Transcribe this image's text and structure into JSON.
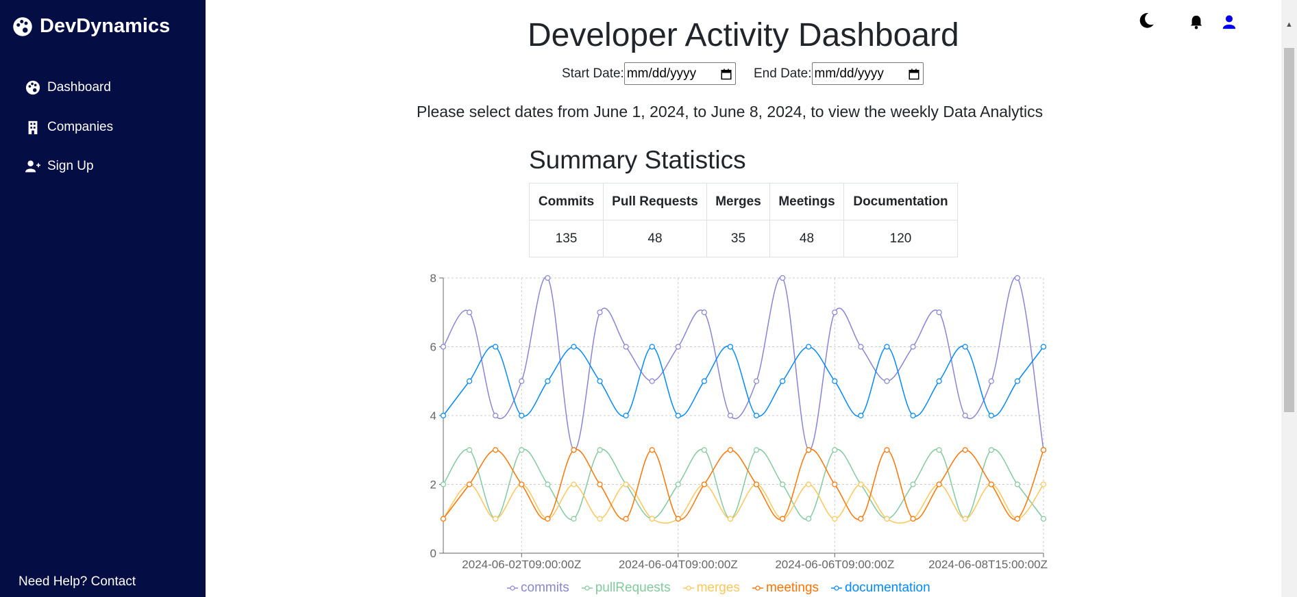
{
  "sidebar": {
    "brand": "DevDynamics",
    "items": [
      {
        "label": "Dashboard",
        "icon": "palette-icon"
      },
      {
        "label": "Companies",
        "icon": "building-icon"
      },
      {
        "label": "Sign Up",
        "icon": "user-plus-icon"
      }
    ],
    "help": "Need Help? Contact"
  },
  "header": {
    "icons": [
      "moon-icon",
      "bell-icon",
      "user-icon"
    ]
  },
  "main": {
    "title": "Developer Activity Dashboard",
    "start_label": "Start Date:",
    "end_label": "End Date:",
    "start_placeholder": "mm/dd/yyyy",
    "end_placeholder": "mm/dd/yyyy",
    "hint": "Please select dates from June 1, 2024, to June 8, 2024, to view the weekly Data Analytics",
    "summary_title": "Summary Statistics",
    "table": {
      "headers": [
        "Commits",
        "Pull Requests",
        "Merges",
        "Meetings",
        "Documentation"
      ],
      "values": [
        "135",
        "48",
        "35",
        "48",
        "120"
      ]
    }
  },
  "chart_data": {
    "type": "line",
    "x_ticks": [
      "2024-06-02T09:00:00Z",
      "2024-06-04T09:00:00Z",
      "2024-06-06T09:00:00Z",
      "2024-06-08T15:00:00Z"
    ],
    "y_ticks": [
      0,
      2,
      4,
      6,
      8
    ],
    "ylim": [
      0,
      8
    ],
    "grid": true,
    "legend_position": "bottom",
    "series": [
      {
        "name": "commits",
        "color": "#8884d8",
        "values": [
          6,
          7,
          4,
          5,
          8,
          3,
          7,
          6,
          5,
          6,
          7,
          4,
          5,
          8,
          3,
          7,
          6,
          5,
          6,
          7,
          4,
          5,
          8,
          3
        ]
      },
      {
        "name": "pullRequests",
        "color": "#82ca9d",
        "values": [
          2,
          3,
          1,
          3,
          2,
          1,
          3,
          2,
          1,
          2,
          3,
          1,
          3,
          2,
          1,
          3,
          2,
          1,
          2,
          3,
          1,
          3,
          2,
          1
        ]
      },
      {
        "name": "merges",
        "color": "#ffc658",
        "values": [
          1,
          2,
          1,
          2,
          1,
          2,
          1,
          2,
          1,
          1,
          2,
          1,
          2,
          1,
          2,
          1,
          2,
          1,
          1,
          2,
          1,
          2,
          1,
          2
        ]
      },
      {
        "name": "meetings",
        "color": "#ff7300",
        "values": [
          1,
          2,
          3,
          2,
          1,
          3,
          2,
          1,
          3,
          1,
          2,
          3,
          2,
          1,
          3,
          2,
          1,
          3,
          1,
          2,
          3,
          2,
          1,
          3
        ]
      },
      {
        "name": "documentation",
        "color": "#0088fe",
        "values": [
          4,
          5,
          6,
          4,
          5,
          6,
          5,
          4,
          6,
          4,
          5,
          6,
          4,
          5,
          6,
          5,
          4,
          6,
          4,
          5,
          6,
          4,
          5,
          6
        ]
      }
    ]
  }
}
